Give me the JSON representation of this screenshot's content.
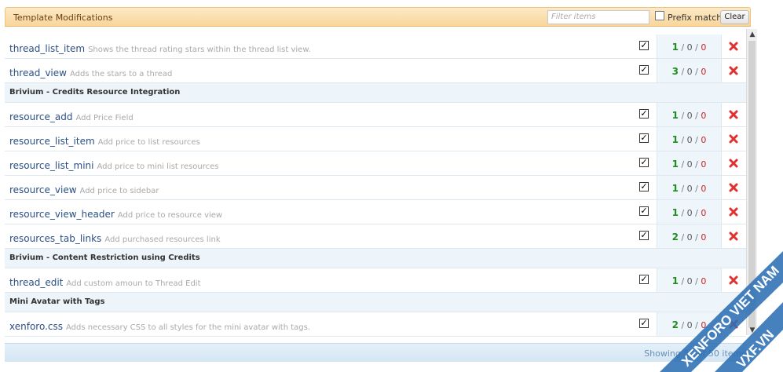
{
  "header": {
    "title": "Template Modifications",
    "filter_placeholder": "Filter items",
    "prefix_match_label": "Prefix match",
    "clear_label": "Clear"
  },
  "rows": [
    {
      "type": "item",
      "name": "thread_list_item",
      "desc": "Shows the thread rating stars within the thread list view.",
      "checked": true,
      "count": "1",
      "z1": "0",
      "z2": "0"
    },
    {
      "type": "item",
      "name": "thread_view",
      "desc": "Adds the stars to a thread",
      "checked": true,
      "count": "3",
      "z1": "0",
      "z2": "0"
    },
    {
      "type": "group",
      "title": "Brivium - Credits Resource Integration"
    },
    {
      "type": "item",
      "name": "resource_add",
      "desc": "Add Price Field",
      "checked": true,
      "count": "1",
      "z1": "0",
      "z2": "0"
    },
    {
      "type": "item",
      "name": "resource_list_item",
      "desc": "Add price to list resources",
      "checked": true,
      "count": "1",
      "z1": "0",
      "z2": "0"
    },
    {
      "type": "item",
      "name": "resource_list_mini",
      "desc": "Add price to mini list resources",
      "checked": true,
      "count": "1",
      "z1": "0",
      "z2": "0"
    },
    {
      "type": "item",
      "name": "resource_view",
      "desc": "Add price to sidebar",
      "checked": true,
      "count": "1",
      "z1": "0",
      "z2": "0"
    },
    {
      "type": "item",
      "name": "resource_view_header",
      "desc": "Add price to resource view",
      "checked": true,
      "count": "1",
      "z1": "0",
      "z2": "0"
    },
    {
      "type": "item",
      "name": "resources_tab_links",
      "desc": "Add purchased resources link",
      "checked": true,
      "count": "2",
      "z1": "0",
      "z2": "0"
    },
    {
      "type": "group",
      "title": "Brivium - Content Restriction using Credits"
    },
    {
      "type": "item",
      "name": "thread_edit",
      "desc": "Add custom amoun to Thread Edit",
      "checked": true,
      "count": "1",
      "z1": "0",
      "z2": "0"
    },
    {
      "type": "group",
      "title": "Mini Avatar with Tags"
    },
    {
      "type": "item",
      "name": "xenforo.css",
      "desc": "Adds necessary CSS to all styles for the mini avatar with tags.",
      "checked": true,
      "count": "2",
      "z1": "0",
      "z2": "0"
    }
  ],
  "footer": {
    "status": "Showing 50 of 50 items"
  },
  "watermark": {
    "line1": "XENFORO VIET NAM",
    "line2": "VXF.VN"
  },
  "colors": {
    "accent_header": "#f8d69c",
    "count_ok": "#1e8f1e",
    "count_error": "#cc2222",
    "link": "#2a4f84"
  }
}
